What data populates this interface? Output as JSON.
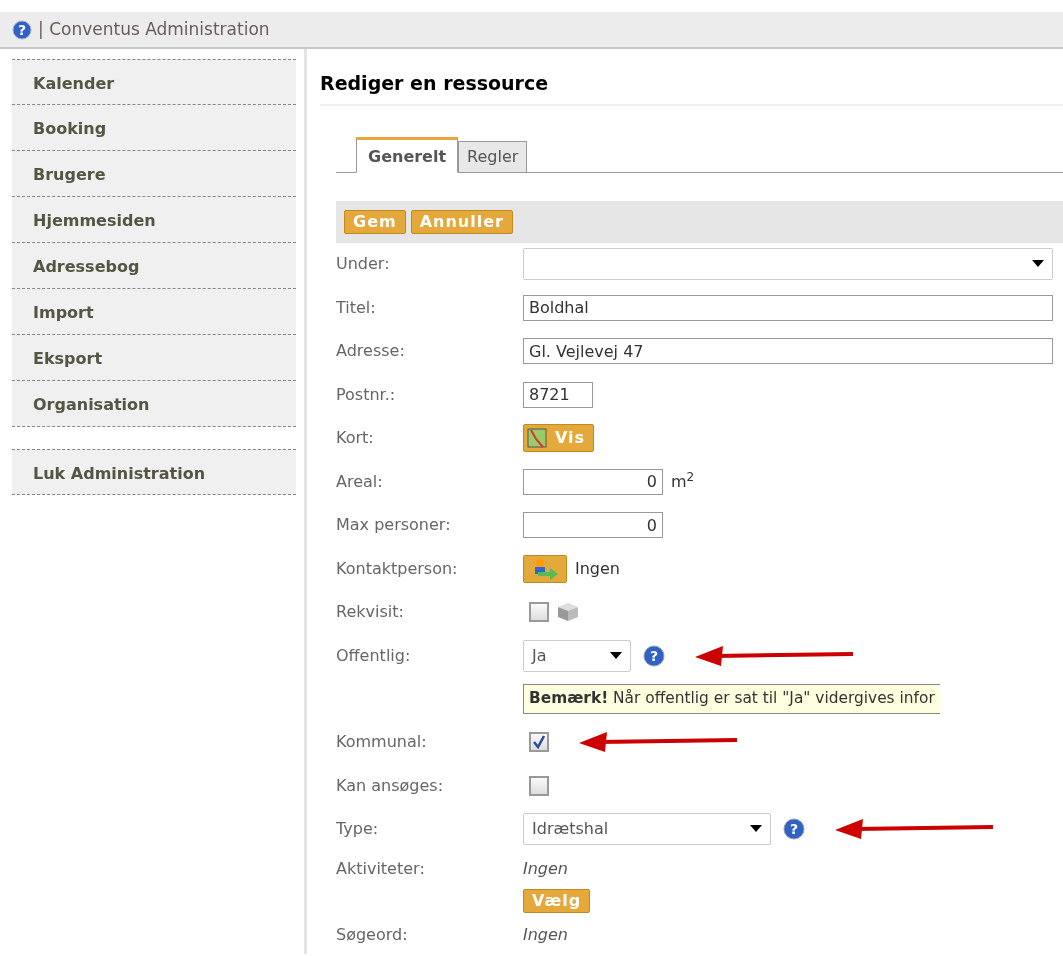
{
  "header": {
    "help_icon": "?",
    "title": "| Conventus Administration"
  },
  "sidebar": {
    "items": [
      {
        "label": "Kalender"
      },
      {
        "label": "Booking"
      },
      {
        "label": "Brugere"
      },
      {
        "label": "Hjemmesiden"
      },
      {
        "label": "Adressebog"
      },
      {
        "label": "Import"
      },
      {
        "label": "Eksport"
      },
      {
        "label": "Organisation"
      }
    ],
    "footer_item": {
      "label": "Luk Administration"
    }
  },
  "page_title": "Rediger en ressource",
  "tabs": [
    {
      "label": "Generelt",
      "selected": true
    },
    {
      "label": "Regler",
      "selected": false
    }
  ],
  "toolbar": [
    "Gem",
    "Annuller"
  ],
  "form": [
    {
      "label": "Under:",
      "kind": "select"
    },
    {
      "label": "Titel:",
      "kind": "text",
      "value": "Boldhal"
    },
    {
      "label": "Adresse:",
      "kind": "text",
      "value": "Gl. Vejlevej 47"
    },
    {
      "label": "Postnr.:",
      "kind": "text",
      "value": "8721"
    },
    {
      "label": "Kort:",
      "kind": "map-button",
      "button": "Vis"
    },
    {
      "label": "Areal:",
      "kind": "number",
      "value": "0",
      "unit": "m$^{2}$"
    },
    {
      "label": "Max personer:",
      "kind": "number",
      "value": "0"
    },
    {
      "label": "Kontaktperson:",
      "kind": "person",
      "value": "Ingen"
    },
    {
      "label": "Rekvisit:",
      "kind": "checkbox",
      "checked": false
    },
    {
      "label": "Offentlig:",
      "kind": "select",
      "value": "Ja",
      "help": "?",
      "annotated": true
    },
    {
      "kind": "note",
      "text": "**Bemærk!** Når offentlig er sat til \"Ja\" vidergives infor"
    },
    {
      "label": "Kommunal:",
      "kind": "checkbox",
      "checked": true,
      "annotated": true
    },
    {
      "label": "Kan ansøges:",
      "kind": "checkbox",
      "checked": false
    },
    {
      "label": "Type:",
      "kind": "select",
      "value": "Idrætshal",
      "help": "?",
      "annotated": true
    },
    {
      "label": "Aktiviteter:",
      "kind": "chooser",
      "value": "Ingen",
      "button": "Vælg"
    },
    {
      "label": "Søgeord:",
      "kind": "value",
      "value": "Ingen"
    }
  ]
}
